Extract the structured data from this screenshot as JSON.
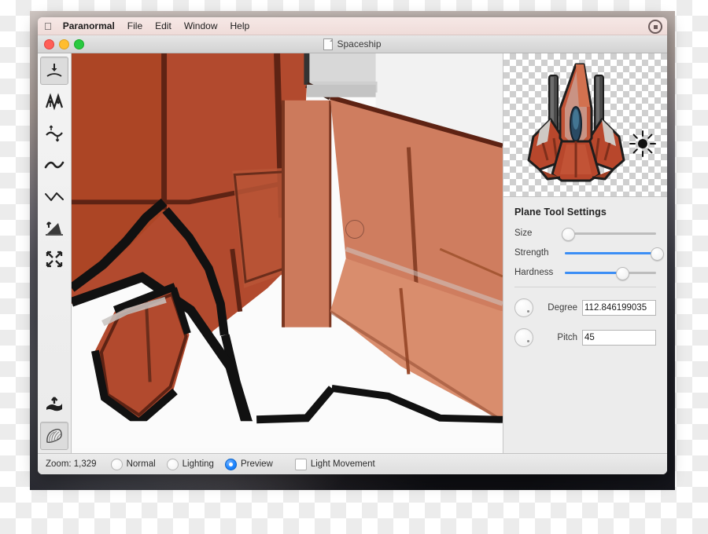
{
  "menubar": {
    "apple_icon": "apple-logo",
    "app_name": "Paranormal",
    "items": [
      {
        "label": "File"
      },
      {
        "label": "Edit"
      },
      {
        "label": "Window"
      },
      {
        "label": "Help"
      }
    ],
    "status_icon": "record-status-icon"
  },
  "window": {
    "title": "Spaceship",
    "document_icon": "document-icon",
    "controls": {
      "close": "close-button",
      "minimize": "minimize-button",
      "zoom": "zoom-button"
    }
  },
  "toolbar": {
    "tools": [
      {
        "name": "push-down-tool",
        "icon": "arrow-down-over-curve-icon",
        "selected": true
      },
      {
        "name": "zigzag-tool",
        "icon": "zigzag-arrows-icon",
        "selected": false
      },
      {
        "name": "smooth-wave-tool",
        "icon": "wave-up-down-arrows-icon",
        "selected": false
      },
      {
        "name": "wave-tool",
        "icon": "thick-wave-icon",
        "selected": false
      },
      {
        "name": "line-wave-tool",
        "icon": "thin-wave-icon",
        "selected": false
      },
      {
        "name": "ramp-tool",
        "icon": "ramp-arrow-icon",
        "selected": false
      },
      {
        "name": "expand-tool",
        "icon": "four-arrows-expand-icon",
        "selected": false
      },
      {
        "name": "extrude-tool",
        "icon": "extrude-arrow-icon",
        "selected": false
      },
      {
        "name": "ribbon-tool",
        "icon": "ribbon-stroke-icon",
        "selected": true
      }
    ]
  },
  "preview": {
    "sprite_name": "spaceship-sprite",
    "light_icon": "sun-light-icon"
  },
  "inspector": {
    "heading": "Plane Tool Settings",
    "sliders": [
      {
        "label": "Size",
        "value": 3,
        "filled": false
      },
      {
        "label": "Strength",
        "value": 100,
        "filled": true
      },
      {
        "label": "Hardness",
        "value": 62,
        "filled": true
      }
    ],
    "fields": [
      {
        "label": "Degree",
        "value": "112.846199035",
        "dial": "degree-dial"
      },
      {
        "label": "Pitch",
        "value": "45",
        "dial": "pitch-dial"
      }
    ]
  },
  "statusbar": {
    "zoom_label": "Zoom: 1,329",
    "radios": [
      {
        "label": "Normal",
        "selected": false
      },
      {
        "label": "Lighting",
        "selected": false
      },
      {
        "label": "Preview",
        "selected": true
      }
    ],
    "checkbox": {
      "label": "Light Movement",
      "checked": false
    }
  },
  "colors": {
    "accent": "#1b84ff",
    "ship_red": "#b8472c",
    "ship_light": "#d2714f",
    "menubar": "#f2e1de"
  }
}
